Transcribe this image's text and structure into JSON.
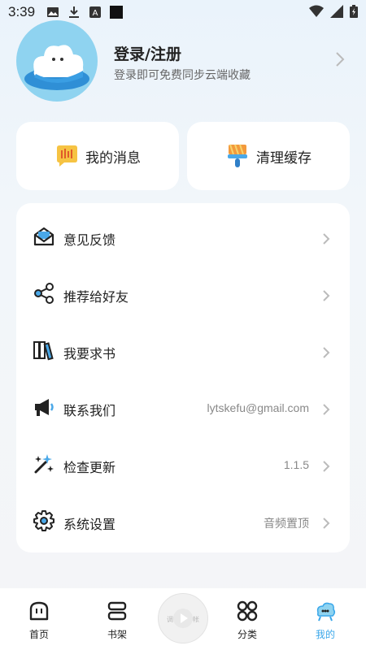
{
  "status_bar": {
    "time": "3:39",
    "icons": [
      "image-icon",
      "download-icon",
      "font-icon",
      "square-icon"
    ],
    "right_icons": [
      "wifi-icon",
      "signal-icon",
      "battery-icon"
    ]
  },
  "profile": {
    "title": "登录/注册",
    "subtitle": "登录即可免费同步云端收藏"
  },
  "quick_actions": [
    {
      "label": "我的消息",
      "icon": "message-icon"
    },
    {
      "label": "清理缓存",
      "icon": "brush-icon"
    }
  ],
  "menu": [
    {
      "label": "意见反馈",
      "value": "",
      "icon": "feedback-icon"
    },
    {
      "label": "推荐给好友",
      "value": "",
      "icon": "share-icon"
    },
    {
      "label": "我要求书",
      "value": "",
      "icon": "books-icon"
    },
    {
      "label": "联系我们",
      "value": "lytskefu@gmail.com",
      "icon": "megaphone-icon"
    },
    {
      "label": "检查更新",
      "value": "1.1.5",
      "icon": "sparkle-icon"
    },
    {
      "label": "系统设置",
      "value": "音频置顶",
      "icon": "gear-icon"
    }
  ],
  "bottom_nav": [
    {
      "label": "首页",
      "icon": "home-icon"
    },
    {
      "label": "书架",
      "icon": "bookshelf-icon"
    },
    {
      "label": "分类",
      "icon": "category-icon"
    },
    {
      "label": "我的",
      "icon": "profile-icon"
    }
  ],
  "center_button": {
    "text_left": "调",
    "text_right": "帐"
  },
  "colors": {
    "accent": "#3aa7ea",
    "active_nav": "#3aa7ea"
  }
}
